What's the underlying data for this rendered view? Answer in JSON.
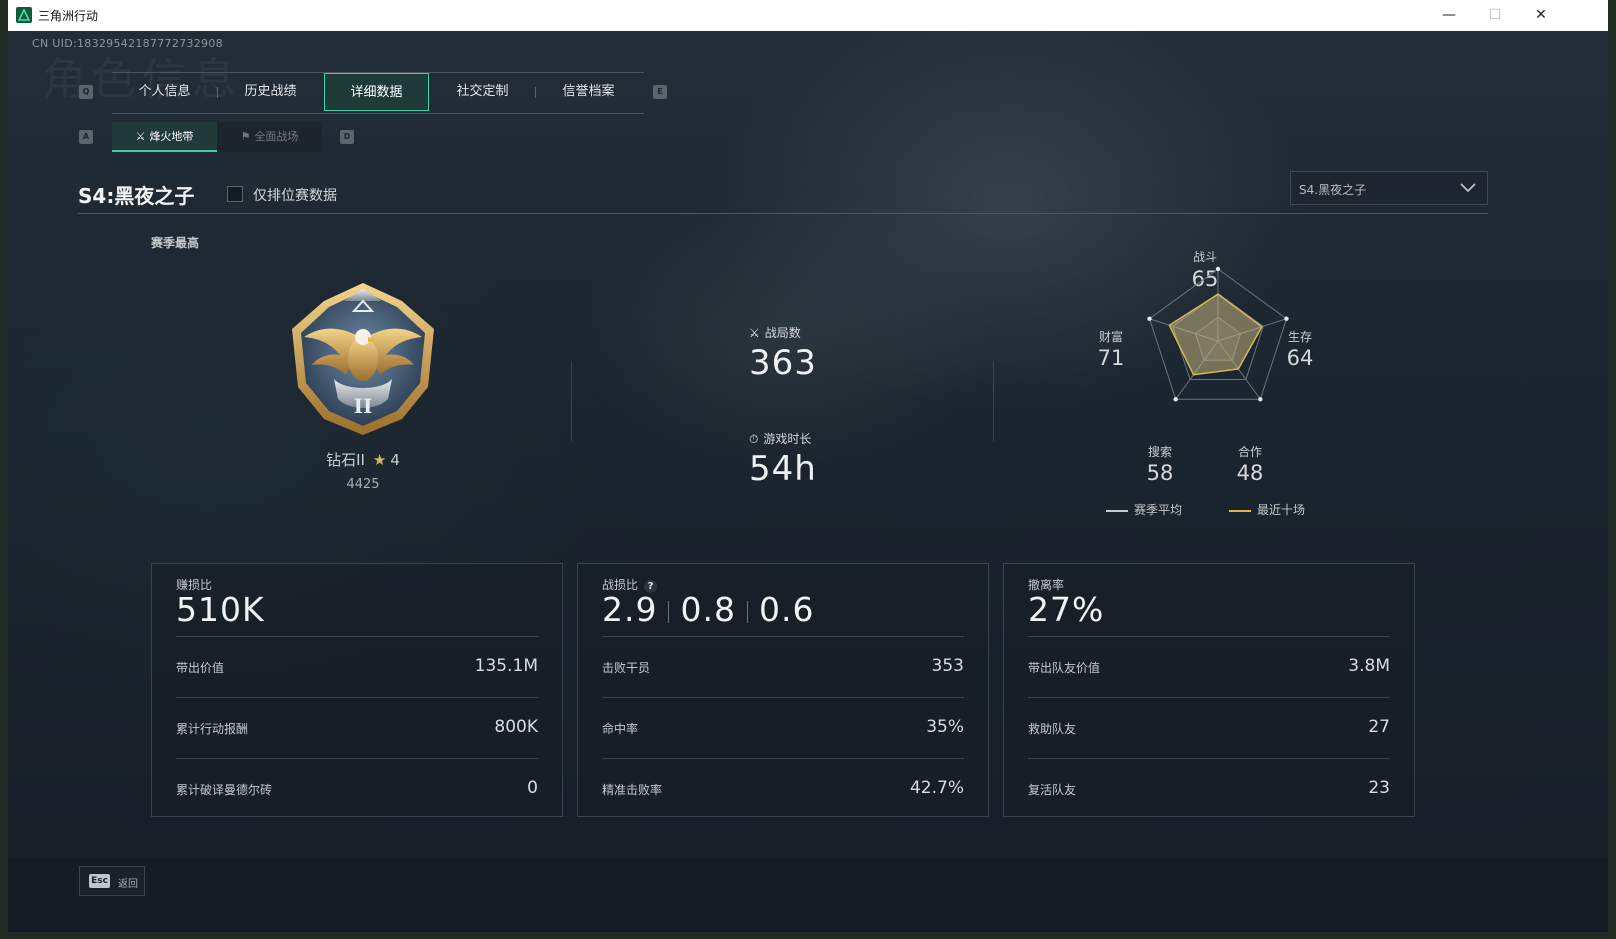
{
  "window": {
    "title": "三角洲行动",
    "minimize": "—",
    "maximize": "☐",
    "close": "✕"
  },
  "header": {
    "uid": "CN UID:18329542187772732908",
    "watermark": "角色信息"
  },
  "tabs": {
    "left_key": "Q",
    "right_key": "E",
    "items": [
      {
        "label": "个人信息"
      },
      {
        "label": "历史战绩"
      },
      {
        "label": "详细数据",
        "active": true
      },
      {
        "label": "社交定制"
      },
      {
        "label": "信誉档案"
      }
    ]
  },
  "subtabs": {
    "left_key": "A",
    "right_key": "D",
    "items": [
      {
        "label": "烽火地带",
        "active": true
      },
      {
        "label": "全面战场"
      }
    ]
  },
  "season": {
    "title": "S4:黑夜之子",
    "ranked_only_label": "仅排位赛数据",
    "ranked_only_checked": false,
    "select_value": "S4.黑夜之子"
  },
  "rank": {
    "section_label": "赛季最高",
    "name": "钻石II",
    "stars": "4",
    "score": "4425"
  },
  "summary": {
    "matches_label": "战局数",
    "matches": "363",
    "playtime_label": "游戏时长",
    "playtime": "54h"
  },
  "radar": {
    "axes": [
      {
        "label": "战斗",
        "value": "65"
      },
      {
        "label": "生存",
        "value": "64"
      },
      {
        "label": "合作",
        "value": "48"
      },
      {
        "label": "搜索",
        "value": "58"
      },
      {
        "label": "财富",
        "value": "71"
      }
    ],
    "legend_season_avg": "赛季平均",
    "legend_recent": "最近十场",
    "color_season_avg": "#c9ccd0",
    "color_recent": "#d8b84e"
  },
  "cards": {
    "profit": {
      "title": "赚损比",
      "value": "510K",
      "rows": [
        {
          "label": "带出价值",
          "value": "135.1M"
        },
        {
          "label": "累计行动报酬",
          "value": "800K"
        },
        {
          "label": "累计破译曼德尔砖",
          "value": "0"
        }
      ]
    },
    "kd": {
      "title": "战损比",
      "help": "?",
      "values": [
        "2.9",
        "0.8",
        "0.6"
      ],
      "rows": [
        {
          "label": "击败干员",
          "value": "353"
        },
        {
          "label": "命中率",
          "value": "35%"
        },
        {
          "label": "精准击败率",
          "value": "42.7%"
        }
      ]
    },
    "extract": {
      "title": "撤离率",
      "value": "27%",
      "rows": [
        {
          "label": "带出队友价值",
          "value": "3.8M"
        },
        {
          "label": "救助队友",
          "value": "27"
        },
        {
          "label": "复活队友",
          "value": "23"
        }
      ]
    }
  },
  "footer": {
    "esc_key": "Esc",
    "back_label": "返回"
  }
}
